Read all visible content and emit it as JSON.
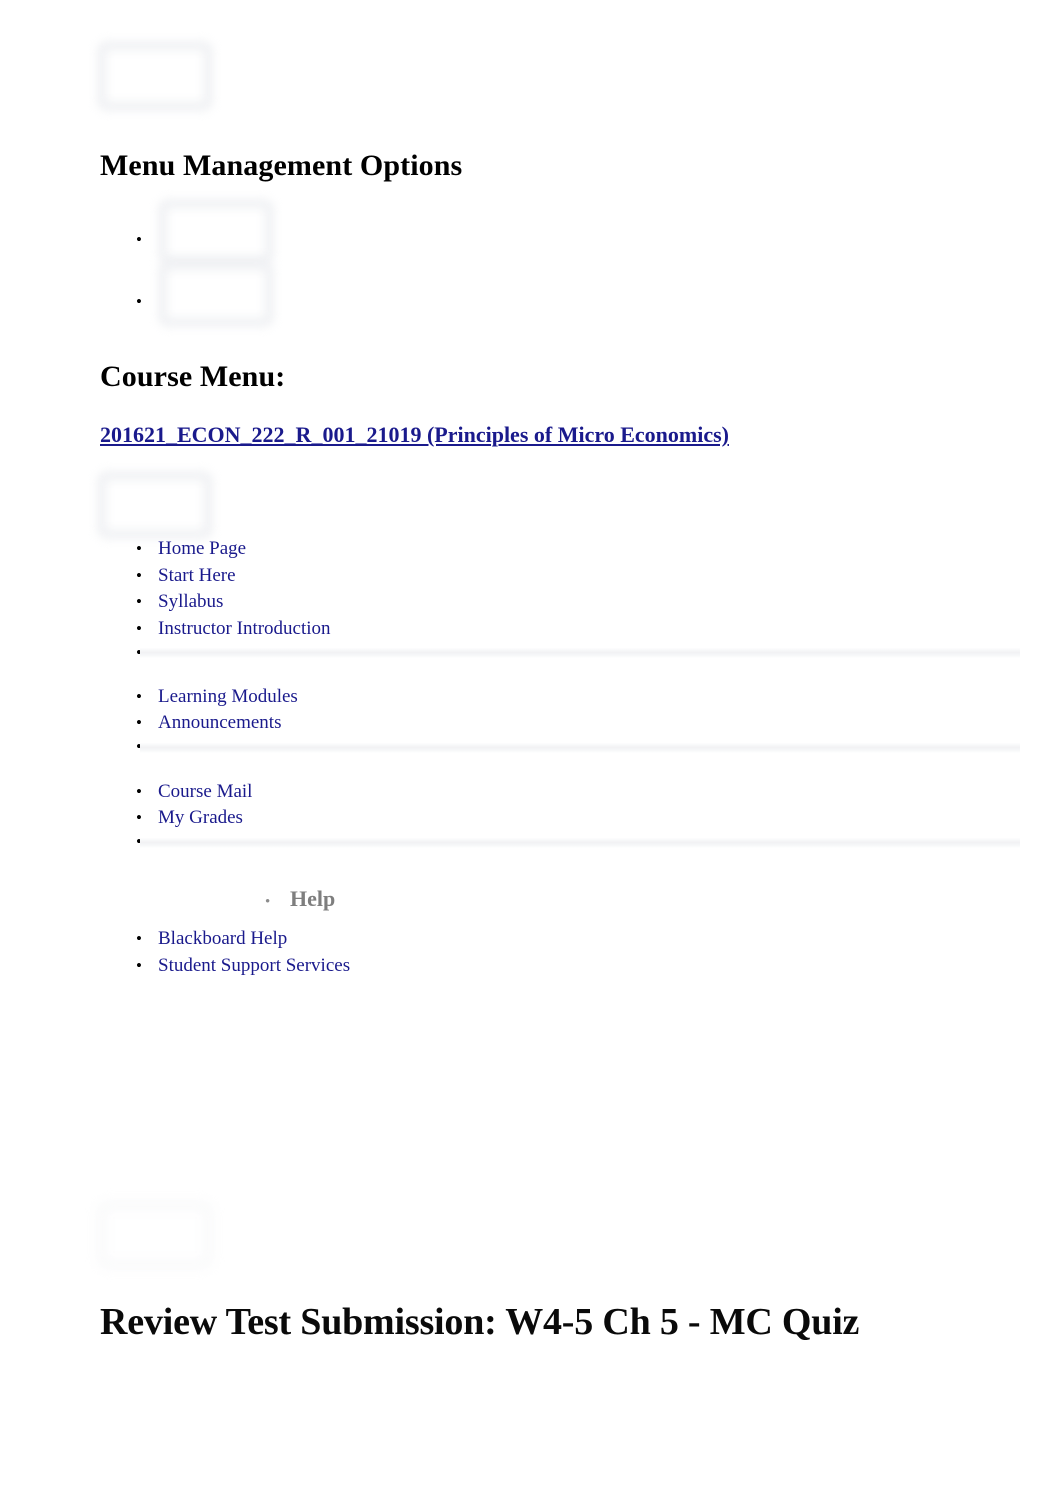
{
  "document": {
    "title": "Review Test Submission: W4-5 Ch 5 - MC Quiz"
  },
  "menu_management": {
    "heading": "Menu Management Options",
    "options": [
      {
        "label": ""
      },
      {
        "label": ""
      }
    ]
  },
  "course_menu": {
    "heading": "Course Menu:",
    "course_link": "201621_ECON_222_R_001_21019 (Principles of Micro Economics)",
    "groups": [
      {
        "items": [
          {
            "label": "Home Page"
          },
          {
            "label": "Start Here"
          },
          {
            "label": "Syllabus"
          },
          {
            "label": "Instructor Introduction"
          },
          {
            "label": ""
          }
        ]
      },
      {
        "items": [
          {
            "label": "Learning Modules"
          },
          {
            "label": "Announcements"
          },
          {
            "label": ""
          }
        ]
      },
      {
        "items": [
          {
            "label": "Course Mail"
          },
          {
            "label": "My Grades"
          },
          {
            "label": ""
          }
        ]
      }
    ],
    "help_section": {
      "heading": "Help",
      "items": [
        {
          "label": "Blackboard Help"
        },
        {
          "label": "Student Support Services"
        }
      ]
    }
  },
  "placeholders": {
    "top_logo": "missing-image-placeholder",
    "menu_options_stack": "missing-image-placeholder",
    "course_menu_header": "missing-image-placeholder",
    "content_header": "missing-image-placeholder"
  },
  "colors": {
    "link": "#1a1a8c",
    "heading": "#000000",
    "help_heading": "#7e7e7e",
    "divider": "#f1f2f4",
    "placeholder_border": "#e8eaee"
  }
}
